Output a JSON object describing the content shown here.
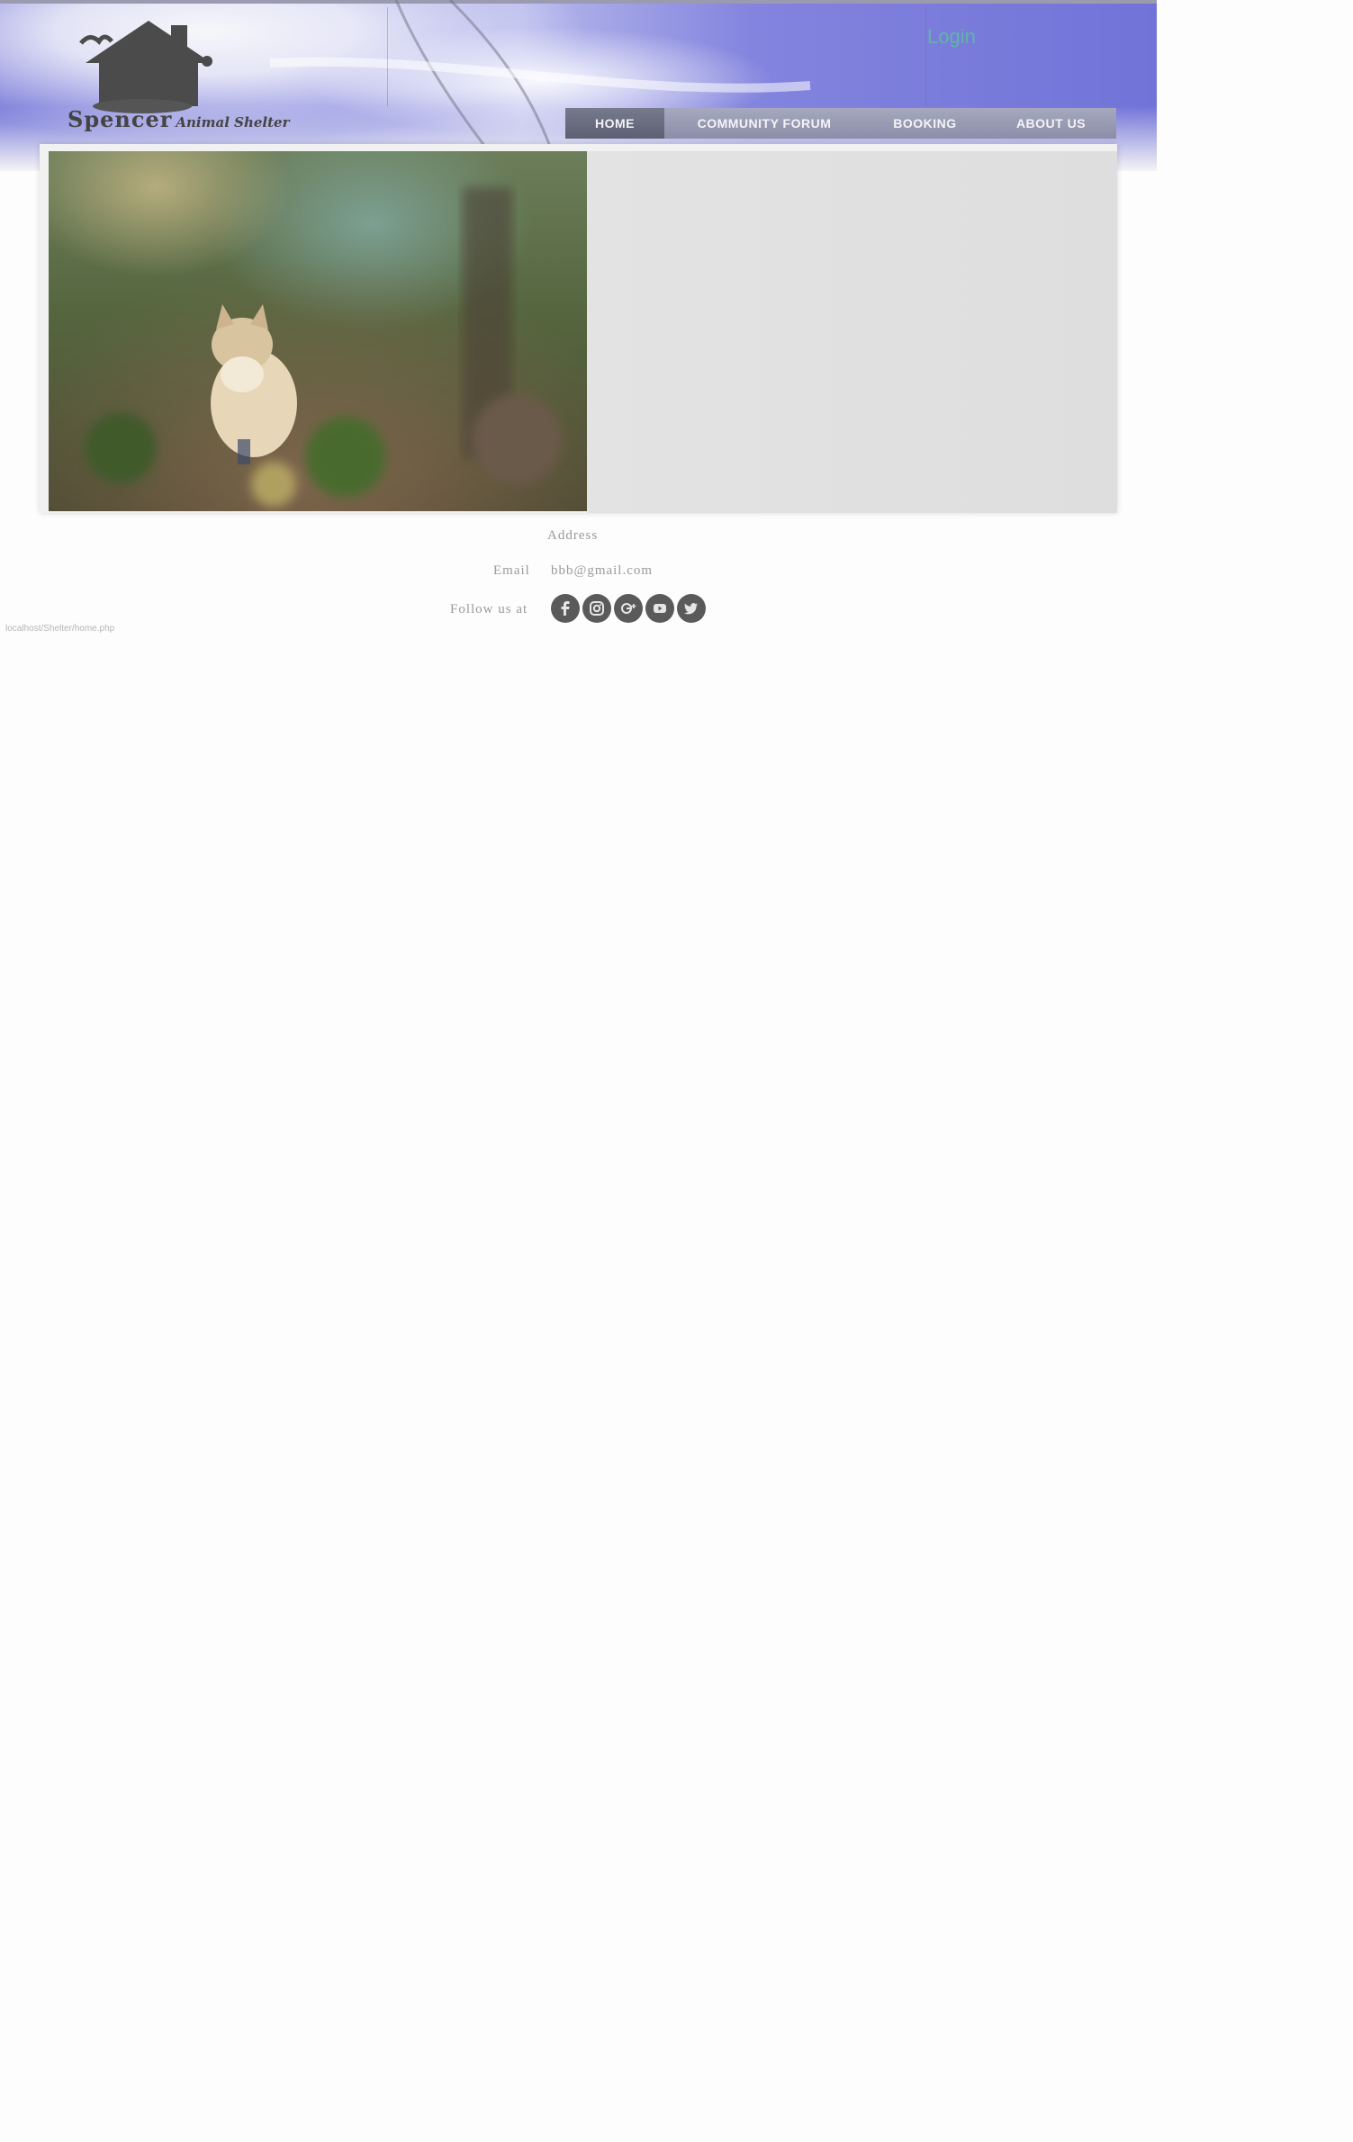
{
  "header": {
    "logo": {
      "name": "Spencer",
      "subtitle": "Animal Shelter"
    },
    "login_label": "Login"
  },
  "nav": {
    "items": [
      {
        "label": "HOME",
        "active": true
      },
      {
        "label": "COMMUNITY FORUM",
        "active": false
      },
      {
        "label": "BOOKING",
        "active": false
      },
      {
        "label": "ABOUT US",
        "active": false
      }
    ]
  },
  "hero": {
    "image": "cat-in-forest-photo"
  },
  "footer": {
    "address_label": "Address",
    "email_label": "Email",
    "email_value": "bbb@gmail.com",
    "follow_label": "Follow us at",
    "social_icons": [
      "facebook-icon",
      "instagram-icon",
      "google-plus-icon",
      "youtube-icon",
      "twitter-icon"
    ]
  },
  "status_bar": {
    "url": "localhost/Shelter/home.php"
  },
  "colors": {
    "header_gradient": "#7173d8",
    "nav_bg": "#8c8ea8",
    "nav_active": "#5d5f73",
    "login": "#5fb5a8",
    "footer_text": "#9a9a9a"
  }
}
